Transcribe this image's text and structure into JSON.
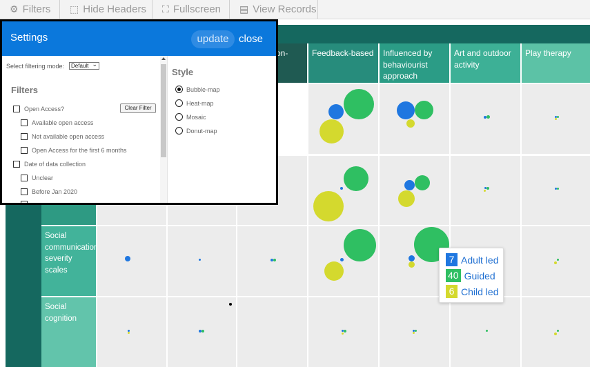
{
  "toolbar": {
    "filters": "Filters",
    "hide_headers": "Hide Headers",
    "fullscreen": "Fullscreen",
    "view_records": "View Records"
  },
  "columns": [
    "on-",
    "Feedback-based",
    "Influenced by behaviourist approach",
    "Art and outdoor activity",
    "Play therapy"
  ],
  "rows": [
    "Social communication severity scales",
    "Social cognition"
  ],
  "legend": {
    "adult_led": {
      "count": "7",
      "label": "Adult led",
      "color": "#1f77e0"
    },
    "guided": {
      "count": "40",
      "label": "Guided",
      "color": "#2fbf62"
    },
    "child_led": {
      "count": "6",
      "label": "Child led",
      "color": "#d4d92e"
    }
  },
  "colors": {
    "header_dark": "#15685f",
    "header_teal": "#2a9d86",
    "cell_bg": "#ececec",
    "panel_blue": "#0b78dc"
  },
  "settings": {
    "title": "Settings",
    "update": "update",
    "close": "close",
    "filter_mode_label": "Select filtering mode:",
    "filter_mode_value": "Default",
    "filters_title": "Filters",
    "clear_filter": "Clear Filter",
    "filters": [
      "Open Access?",
      "Available open access",
      "Not available open access",
      "Open Access for the first 6 months",
      "Date of data collection",
      "Unclear",
      "Before Jan 2020"
    ],
    "style_title": "Style",
    "styles": [
      "Bubble-map",
      "Heat-map",
      "Mosaic",
      "Donut-map"
    ],
    "selected_style": "Bubble-map"
  }
}
